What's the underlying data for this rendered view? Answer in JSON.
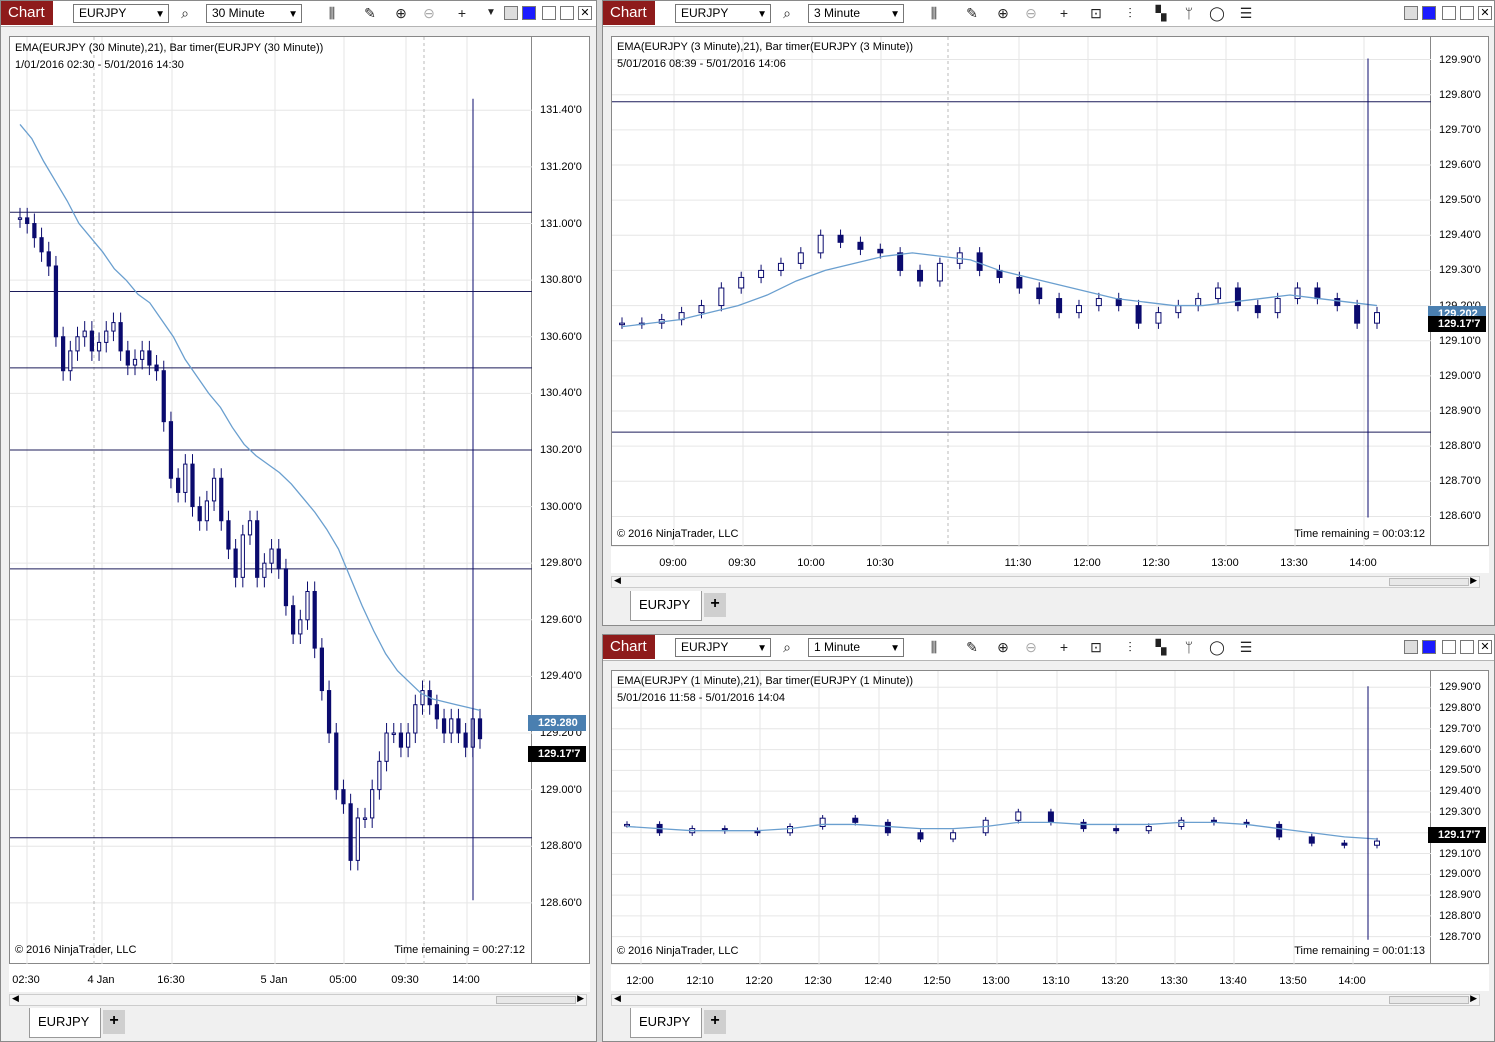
{
  "colors": {
    "candle": "#0b0b6e",
    "ema": "#6a9fcf",
    "hline": "#1c1c5a",
    "badge_ema": "#4a7fb0"
  },
  "icons": [
    "search-icon",
    "bars-icon",
    "pencil-icon",
    "zoom-in-icon",
    "zoom-out-icon",
    "crosshair-icon",
    "dropdown-icon",
    "chart-style-icon",
    "data-box-icon",
    "indicators-icon",
    "strategy-icon",
    "properties-icon",
    "list-icon"
  ],
  "windows": {
    "left": {
      "title": "Chart",
      "instrument": "EURJPY",
      "interval": "30 Minute",
      "header": "EMA(EURJPY (30 Minute),21), Bar timer(EURJPY (30 Minute))",
      "daterange": "1/01/2016 02:30 - 5/01/2016 14:30",
      "copyright": "© 2016 NinjaTrader, LLC",
      "timer": "Time remaining = 00:27:12",
      "tab": "EURJPY",
      "price_ema": "129.280",
      "price_last": "129.17'7"
    },
    "top": {
      "title": "Chart",
      "instrument": "EURJPY",
      "interval": "3 Minute",
      "header": "EMA(EURJPY (3 Minute),21), Bar timer(EURJPY (3 Minute))",
      "daterange": "5/01/2016 08:39 - 5/01/2016 14:06",
      "copyright": "© 2016 NinjaTrader, LLC",
      "timer": "Time remaining = 00:03:12",
      "tab": "EURJPY",
      "price_ema": "129.202",
      "price_last": "129.17'7"
    },
    "bottom": {
      "title": "Chart",
      "instrument": "EURJPY",
      "interval": "1 Minute",
      "header": "EMA(EURJPY (1 Minute),21), Bar timer(EURJPY (1 Minute))",
      "daterange": "5/01/2016 11:58 - 5/01/2016 14:04",
      "copyright": "© 2016 NinjaTrader, LLC",
      "timer": "Time remaining = 00:01:13",
      "tab": "EURJPY",
      "price_last": "129.17'7"
    }
  },
  "chart_data": [
    {
      "type": "candlestick",
      "id": "left",
      "title": "EMA(EURJPY (30 Minute),21), Bar timer(EURJPY (30 Minute))",
      "ylim": [
        128.55,
        131.5
      ],
      "yticks": [
        "131.40'0",
        "131.20'0",
        "131.00'0",
        "130.80'0",
        "130.60'0",
        "130.40'0",
        "130.20'0",
        "130.00'0",
        "129.80'0",
        "129.60'0",
        "129.40'0",
        "129.20'0",
        "129.00'0",
        "128.80'0",
        "128.60'0"
      ],
      "xticks": [
        "02:30",
        "4 Jan",
        "16:30",
        "5 Jan",
        "05:00",
        "09:30",
        "14:00"
      ],
      "hlines": [
        131.04,
        130.76,
        130.49,
        130.2,
        129.78,
        128.83
      ],
      "closes": [
        131.02,
        131.0,
        130.95,
        130.9,
        130.85,
        130.6,
        130.48,
        130.55,
        130.6,
        130.62,
        130.55,
        130.58,
        130.62,
        130.65,
        130.55,
        130.5,
        130.52,
        130.55,
        130.5,
        130.48,
        130.3,
        130.1,
        130.05,
        130.15,
        130.0,
        129.95,
        130.02,
        130.1,
        129.95,
        129.85,
        129.75,
        129.9,
        129.95,
        129.75,
        129.8,
        129.85,
        129.78,
        129.65,
        129.55,
        129.6,
        129.7,
        129.5,
        129.35,
        129.2,
        129.0,
        128.95,
        128.75,
        128.9,
        128.9,
        129.0,
        129.1,
        129.2,
        129.2,
        129.15,
        129.2,
        129.3,
        129.35,
        129.3,
        129.25,
        129.2,
        129.25,
        129.2,
        129.15,
        129.25,
        129.18
      ],
      "ema": [
        131.35,
        131.3,
        131.22,
        131.15,
        131.08,
        131.0,
        130.95,
        130.9,
        130.84,
        130.8,
        130.75,
        130.72,
        130.66,
        130.6,
        130.52,
        130.46,
        130.4,
        130.35,
        130.28,
        130.22,
        130.18,
        130.15,
        130.12,
        130.08,
        130.03,
        129.98,
        129.92,
        129.85,
        129.75,
        129.65,
        129.56,
        129.48,
        129.42,
        129.38,
        129.34,
        129.32,
        129.31,
        129.3,
        129.29,
        129.28
      ]
    },
    {
      "type": "candlestick",
      "id": "top",
      "title": "EMA(EURJPY (3 Minute),21), Bar timer(EURJPY (3 Minute))",
      "ylim": [
        128.57,
        129.93
      ],
      "yticks": [
        "129.90'0",
        "129.80'0",
        "129.70'0",
        "129.60'0",
        "129.50'0",
        "129.40'0",
        "129.30'0",
        "129.20'0",
        "129.10'0",
        "129.00'0",
        "128.90'0",
        "128.80'0",
        "128.70'0",
        "128.60'0"
      ],
      "xticks": [
        "09:00",
        "09:30",
        "10:00",
        "10:30",
        "11:30",
        "12:00",
        "12:30",
        "13:00",
        "13:30",
        "14:00"
      ],
      "hlines": [
        129.78,
        128.84
      ],
      "closes": [
        129.15,
        129.15,
        129.16,
        129.18,
        129.2,
        129.25,
        129.28,
        129.3,
        129.32,
        129.35,
        129.4,
        129.38,
        129.36,
        129.35,
        129.3,
        129.27,
        129.32,
        129.35,
        129.3,
        129.28,
        129.25,
        129.22,
        129.18,
        129.2,
        129.22,
        129.2,
        129.15,
        129.18,
        129.2,
        129.22,
        129.25,
        129.2,
        129.18,
        129.22,
        129.25,
        129.22,
        129.2,
        129.15,
        129.18
      ],
      "ema": [
        129.14,
        129.15,
        129.16,
        129.18,
        129.2,
        129.23,
        129.27,
        129.3,
        129.32,
        129.34,
        129.35,
        129.34,
        129.33,
        129.3,
        129.28,
        129.26,
        129.24,
        129.22,
        129.21,
        129.2,
        129.2,
        129.21,
        129.22,
        129.23,
        129.22,
        129.21,
        129.2
      ]
    },
    {
      "type": "candlestick",
      "id": "bottom",
      "title": "EMA(EURJPY (1 Minute),21), Bar timer(EURJPY (1 Minute))",
      "ylim": [
        128.66,
        129.93
      ],
      "yticks": [
        "129.90'0",
        "129.80'0",
        "129.70'0",
        "129.60'0",
        "129.50'0",
        "129.40'0",
        "129.30'0",
        "129.20'0",
        "129.10'0",
        "129.00'0",
        "128.90'0",
        "128.80'0",
        "128.70'0"
      ],
      "xticks": [
        "12:00",
        "12:10",
        "12:20",
        "12:30",
        "12:40",
        "12:50",
        "13:00",
        "13:10",
        "13:20",
        "13:30",
        "13:40",
        "13:50",
        "14:00"
      ],
      "closes": [
        129.24,
        129.2,
        129.22,
        129.21,
        129.2,
        129.23,
        129.27,
        129.25,
        129.2,
        129.17,
        129.2,
        129.26,
        129.3,
        129.25,
        129.22,
        129.21,
        129.23,
        129.26,
        129.25,
        129.24,
        129.18,
        129.15,
        129.14,
        129.16
      ],
      "ema": [
        129.23,
        129.22,
        129.21,
        129.21,
        129.21,
        129.22,
        129.24,
        129.24,
        129.23,
        129.22,
        129.22,
        129.23,
        129.25,
        129.25,
        129.24,
        129.24,
        129.24,
        129.25,
        129.25,
        129.24,
        129.22,
        129.2,
        129.18,
        129.17
      ]
    }
  ]
}
